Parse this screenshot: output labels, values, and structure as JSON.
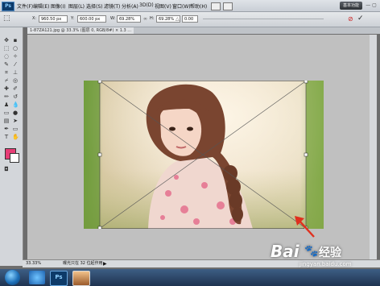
{
  "app": {
    "logo": "Ps"
  },
  "menu": {
    "items": [
      "文件(F)",
      "编辑(E)",
      "图像(I)",
      "图层(L)",
      "选择(S)",
      "滤镜(T)",
      "分析(A)",
      "3D(D)",
      "视图(V)",
      "窗口(W)",
      "帮助(H)"
    ],
    "basic_label": "基本功能"
  },
  "options": {
    "x_value": "960.50 px",
    "y_value": "600.00 px",
    "w_value": "69.28%",
    "h_value": "69.28%",
    "angle_value": "0.00",
    "x_label": "X:",
    "y_label": "Y:",
    "w_label": "W:",
    "h_label": "H:"
  },
  "document": {
    "tab_title": "1-87ZA121.jpg @ 33.3% (图层 0, RGB/8#) × 1.3 ..."
  },
  "status": {
    "zoom": "33.33%",
    "info": "曝光只在 32 位起作用"
  },
  "colors": {
    "foreground": "#e73d76",
    "background": "#ffffff",
    "accent": "#e0301e"
  },
  "watermark": {
    "brand": "Bai",
    "brand2": "经验",
    "url": "jingyan.baidu.com"
  },
  "taskbar": {
    "apps": [
      "windows-start",
      "internet-explorer",
      "photoshop",
      "image-viewer"
    ]
  }
}
